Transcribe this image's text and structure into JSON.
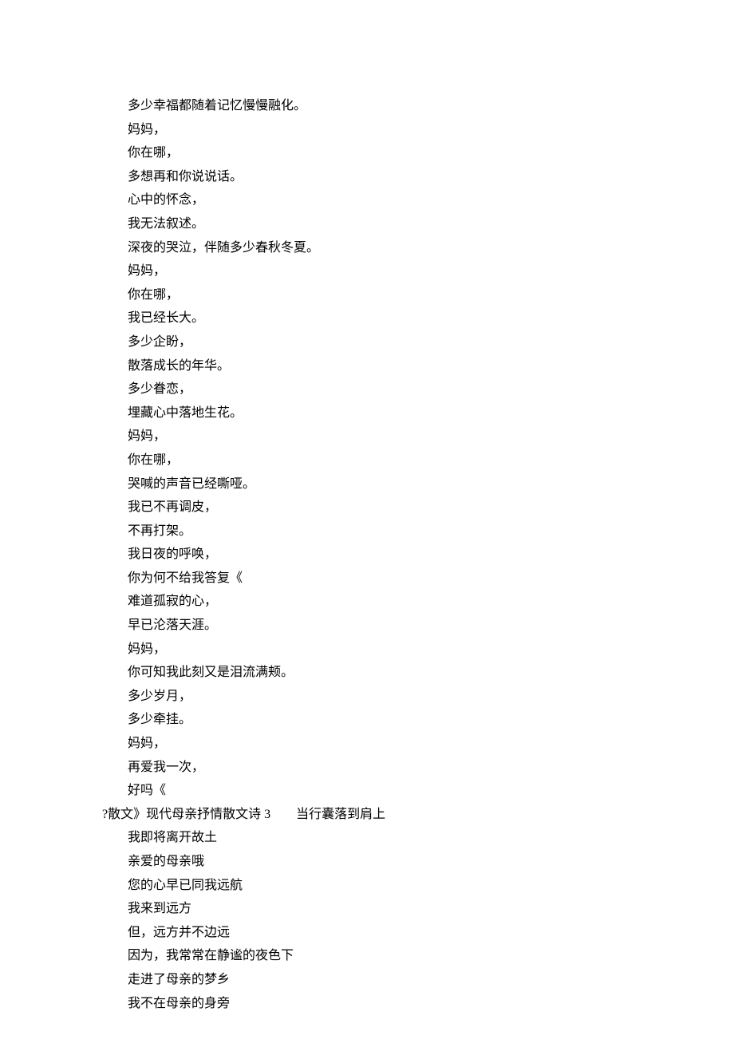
{
  "lines": [
    {
      "indent": 2,
      "text": "多少幸福都随着记忆慢慢融化。"
    },
    {
      "indent": 2,
      "text": "妈妈，"
    },
    {
      "indent": 2,
      "text": "你在哪，"
    },
    {
      "indent": 2,
      "text": "多想再和你说说话。"
    },
    {
      "indent": 2,
      "text": "心中的怀念，"
    },
    {
      "indent": 2,
      "text": "我无法叙述。"
    },
    {
      "indent": 2,
      "text": "深夜的哭泣，伴随多少春秋冬夏。"
    },
    {
      "indent": 2,
      "text": "妈妈，"
    },
    {
      "indent": 2,
      "text": "你在哪，"
    },
    {
      "indent": 2,
      "text": "我已经长大。"
    },
    {
      "indent": 2,
      "text": "多少企盼，"
    },
    {
      "indent": 2,
      "text": "散落成长的年华。"
    },
    {
      "indent": 2,
      "text": "多少眷恋，"
    },
    {
      "indent": 2,
      "text": "埋藏心中落地生花。"
    },
    {
      "indent": 2,
      "text": "妈妈，"
    },
    {
      "indent": 2,
      "text": "你在哪，"
    },
    {
      "indent": 2,
      "text": "哭喊的声音已经嘶哑。"
    },
    {
      "indent": 2,
      "text": "我已不再调皮，"
    },
    {
      "indent": 2,
      "text": "不再打架。"
    },
    {
      "indent": 2,
      "text": "我日夜的呼唤，"
    },
    {
      "indent": 2,
      "text": "你为何不给我答复《"
    },
    {
      "indent": 2,
      "text": "难道孤寂的心，"
    },
    {
      "indent": 2,
      "text": "早已沦落天涯。"
    },
    {
      "indent": 2,
      "text": "妈妈，"
    },
    {
      "indent": 2,
      "text": "你可知我此刻又是泪流满颊。"
    },
    {
      "indent": 2,
      "text": "多少岁月，"
    },
    {
      "indent": 2,
      "text": "多少牵挂。"
    },
    {
      "indent": 2,
      "text": "妈妈，"
    },
    {
      "indent": 2,
      "text": "再爱我一次，"
    },
    {
      "indent": 2,
      "text": "好吗《"
    },
    {
      "indent": 0,
      "text": "?散文》现代母亲抒情散文诗 3　　当行囊落到肩上"
    },
    {
      "indent": 2,
      "text": "我即将离开故土"
    },
    {
      "indent": 2,
      "text": "亲爱的母亲哦"
    },
    {
      "indent": 2,
      "text": "您的心早已同我远航"
    },
    {
      "indent": 2,
      "text": "我来到远方"
    },
    {
      "indent": 2,
      "text": "但，远方并不边远"
    },
    {
      "indent": 2,
      "text": "因为，我常常在静谧的夜色下"
    },
    {
      "indent": 2,
      "text": "走进了母亲的梦乡"
    },
    {
      "indent": 2,
      "text": "我不在母亲的身旁"
    }
  ]
}
